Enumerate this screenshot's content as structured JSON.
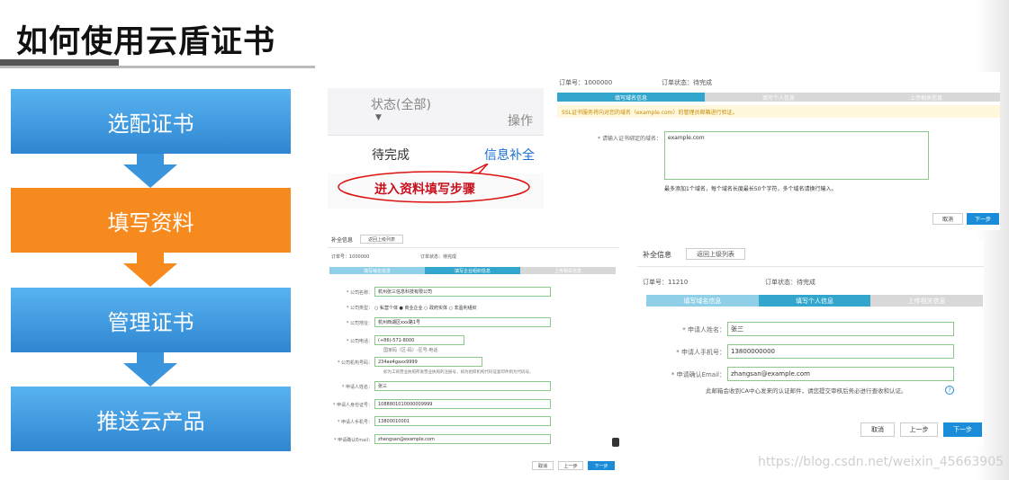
{
  "slide": {
    "title": "如何使用云盾证书"
  },
  "steps": [
    {
      "label": "选配证书"
    },
    {
      "label": "填写资料"
    },
    {
      "label": "管理证书"
    },
    {
      "label": "推送云产品"
    }
  ],
  "order_table": {
    "status_header": "状态(全部)",
    "action_header": "操作",
    "row_status": "待完成",
    "row_action": "信息补全",
    "callout": "进入资料填写步骤"
  },
  "domain_panel": {
    "order_no": "订单号：1000000",
    "order_status": "订单状态：待完成",
    "steps": [
      "填写域名信息",
      "填写个人信息",
      "上传相关信息"
    ],
    "notice": "SSL证书服务将向对您的域名（example.com）的管理员邮箱进行验证。",
    "field_label": "* 请输入证书绑定的域名：",
    "field_value": "example.com",
    "hint": "最多添加1个域名，每个域名长度最长50个字符，多个域名请换行输入。",
    "cancel": "取消",
    "next": "下一步"
  },
  "company_panel": {
    "header": "补全信息",
    "back": "返回上级列表",
    "order_no": "订单号：1000000",
    "order_status": "订单状态：待完成",
    "steps": [
      "填写域名信息",
      "填写企业组织信息",
      "上传相关信息"
    ],
    "fields": [
      {
        "label": "* 公司名称：",
        "value": "杭州张三信息科技有限公司"
      },
      {
        "label": "* 公司类型：",
        "value": "○ 私营个体  ● 商业企业  ○ 政府实体  ○ 非盈利组织"
      },
      {
        "label": "* 公司地址：",
        "value": "杭州西湖区xxx路1号"
      },
      {
        "label": "* 公司电话：",
        "value": "(+86)-571-8000"
      },
      {
        "label": "* 公司机构号码：",
        "value": "234ae4gaxx9999"
      },
      {
        "label": "* 申请人姓名：",
        "value": "张三"
      },
      {
        "label": "* 申请人身份证号：",
        "value": "1088801010000009999"
      },
      {
        "label": "* 申请人手机号：",
        "value": "13800010001"
      },
      {
        "label": "* 申请确认Email：",
        "value": "zhangsan@example.com"
      }
    ],
    "phone_hint": "国家码（区-码）-区号-电话",
    "org_hint": "如为工商营业执照所发营业执照的注册号，如为组织机构代码证复印件则为代码号。",
    "cancel": "取消",
    "prev": "上一步",
    "next": "下一步"
  },
  "personal_panel": {
    "header": "补全信息",
    "back": "返回上级列表",
    "order_no": "订单号：11210",
    "order_status": "订单状态：待完成",
    "steps": [
      "填写域名信息",
      "填写个人信息",
      "上传相关信息"
    ],
    "fields": [
      {
        "label": "* 申请人姓名：",
        "value": "张三"
      },
      {
        "label": "* 申请人手机号：",
        "value": "13800000000"
      },
      {
        "label": "* 申请确认Email：",
        "value": "zhangsan@example.com"
      }
    ],
    "email_hint": "此邮箱会收到CA中心发来的认证邮件，请您提交审核后务必进行查收和认证。",
    "cancel": "取消",
    "prev": "上一步",
    "next": "下一步"
  },
  "watermark": "https://blog.csdn.net/weixin_45663905",
  "colors": {
    "step_blue": "#3b95dc",
    "step_orange": "#f68a1e",
    "primary": "#1a8cd8",
    "progress_active": "#32a6cc",
    "progress_done": "#8fd0e8"
  }
}
